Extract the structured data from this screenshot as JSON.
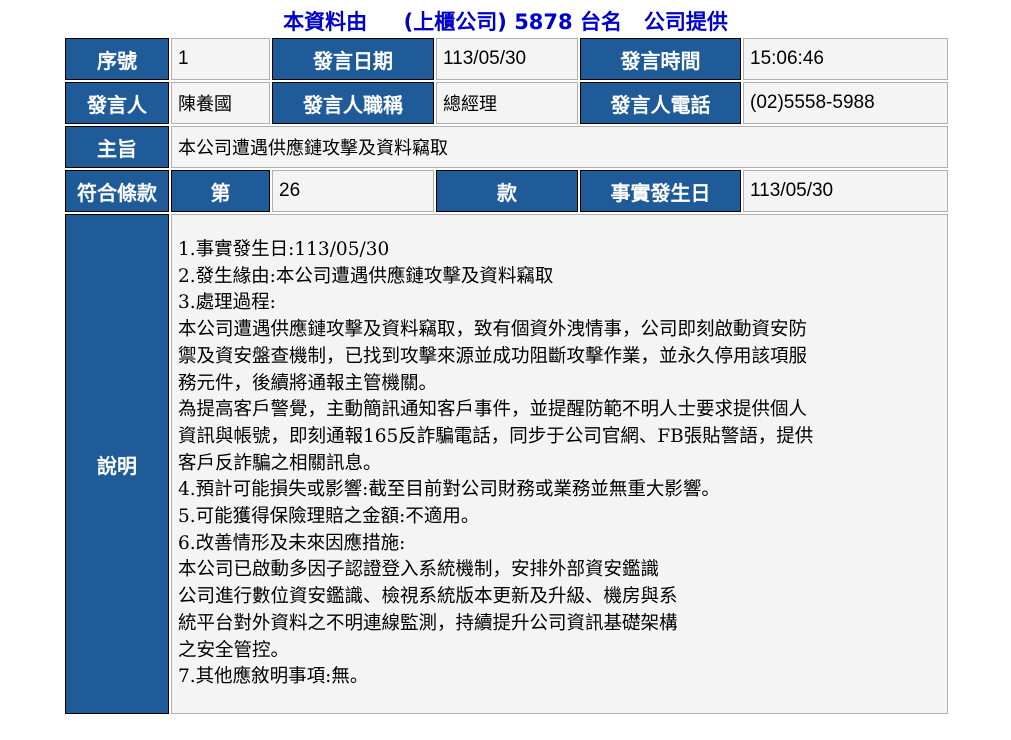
{
  "header": {
    "prefix": "本資料由",
    "company_type": "(上櫃公司)",
    "code": "5878",
    "name": "台名",
    "suffix": "公司提供"
  },
  "fields": {
    "seq_label": "序號",
    "seq_value": "1",
    "date_label": "發言日期",
    "date_value": "113/05/30",
    "time_label": "發言時間",
    "time_value": "15:06:46",
    "speaker_label": "發言人",
    "speaker_value": "陳養國",
    "title_label": "發言人職稱",
    "title_value": "總經理",
    "phone_label": "發言人電話",
    "phone_value": "(02)5558-5988",
    "subject_label": "主旨",
    "subject_value": "本公司遭遇供應鏈攻擊及資料竊取",
    "clause_label": "符合條款",
    "clause_prefix": "第",
    "clause_value": "26",
    "clause_suffix": "款",
    "event_date_label": "事實發生日",
    "event_date_value": "113/05/30",
    "desc_label": "說明"
  },
  "description": [
    "1.事實發生日:113/05/30",
    "2.發生緣由:本公司遭遇供應鏈攻擊及資料竊取",
    "3.處理過程:",
    "本公司遭遇供應鏈攻擊及資料竊取，致有個資外洩情事，公司即刻啟動資安防",
    "禦及資安盤查機制，已找到攻擊來源並成功阻斷攻擊作業，並永久停用該項服",
    "務元件，後續將通報主管機關。",
    "為提高客戶警覺，主動簡訊通知客戶事件，並提醒防範不明人士要求提供個人",
    "資訊與帳號，即刻通報165反詐騙電話，同步于公司官網、FB張貼警語，提供",
    "客戶反詐騙之相關訊息。",
    "4.預計可能損失或影響:截至目前對公司財務或業務並無重大影響。",
    "5.可能獲得保險理賠之金額:不適用。",
    "6.改善情形及未來因應措施:",
    "本公司已啟動多因子認證登入系統機制，安排外部資安鑑識",
    "公司進行數位資安鑑識、檢視系統版本更新及升級、機房與系",
    "統平台對外資料之不明連線監測，持續提升公司資訊基礎架構",
    "之安全管控。",
    "7.其他應敘明事項:無。"
  ]
}
